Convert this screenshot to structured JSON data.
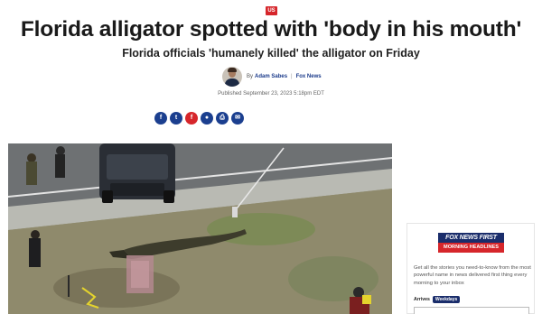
{
  "article": {
    "category": "US",
    "headline": "Florida alligator spotted with 'body in his mouth'",
    "subheadline": "Florida officials 'humanely killed' the alligator on Friday",
    "byline_prefix": "By",
    "author": "Adam Sabes",
    "outlet": "Fox News",
    "published": "Published September 23, 2023 5:18pm EDT"
  },
  "share": {
    "buttons": [
      {
        "icon": "facebook-icon",
        "glyph": "f"
      },
      {
        "icon": "twitter-icon",
        "glyph": "t"
      },
      {
        "icon": "flipboard-icon",
        "glyph": "f"
      },
      {
        "icon": "comments-icon",
        "glyph": "●"
      },
      {
        "icon": "print-icon",
        "glyph": "⎙"
      },
      {
        "icon": "email-icon",
        "glyph": "✉"
      }
    ]
  },
  "newsletter": {
    "brand": "FOX NEWS FIRST",
    "subtitle": "MORNING HEADLINES",
    "description": "Get all the stories you need-to-know from the most powerful name in news delivered first thing every morning to your inbox",
    "arrives_label": "Arrives",
    "frequency": "Weekdays"
  },
  "colors": {
    "accent_red": "#d6262b",
    "brand_navy": "#1a2d6b",
    "link_blue": "#1a3a8a"
  }
}
